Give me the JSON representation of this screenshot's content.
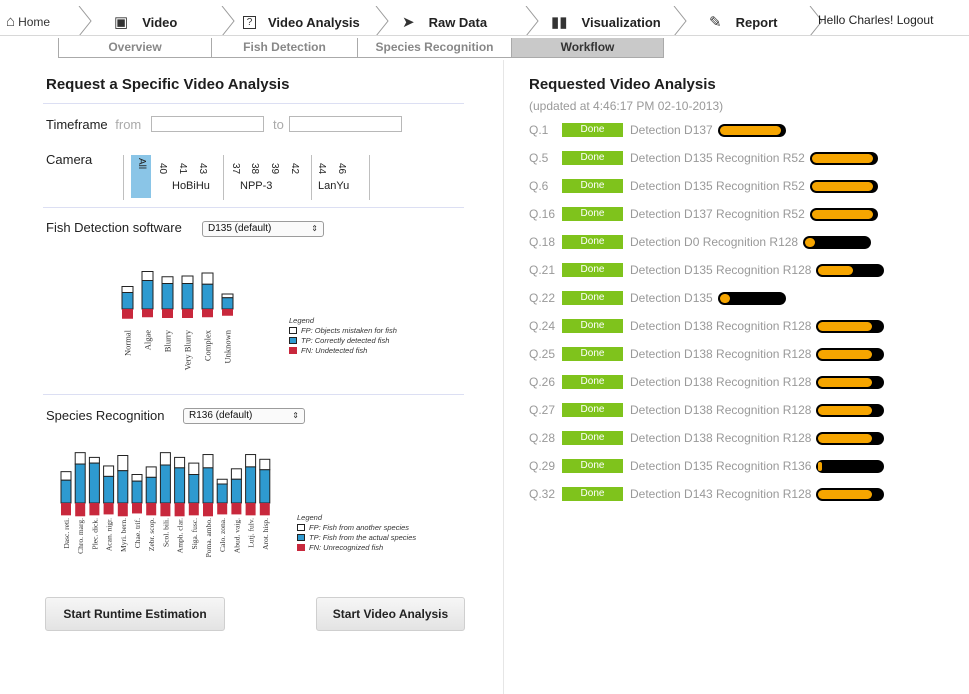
{
  "nav": {
    "home": "Home",
    "steps": [
      {
        "label": "Video",
        "icon": "video-icon"
      },
      {
        "label": "Video Analysis",
        "icon": "help-icon"
      },
      {
        "label": "Raw Data",
        "icon": "fish-icon"
      },
      {
        "label": "Visualization",
        "icon": "bar-chart-icon"
      },
      {
        "label": "Report",
        "icon": "edit-icon"
      }
    ],
    "greeting": "Hello Charles!",
    "logout": "Logout"
  },
  "subtabs": [
    "Overview",
    "Fish Detection",
    "Species Recognition",
    "Workflow"
  ],
  "request": {
    "title": "Request a Specific Video Analysis",
    "timeframe_label": "Timeframe",
    "from_label": "from",
    "to_label": "to",
    "from_value": "",
    "to_value": "",
    "camera_label": "Camera",
    "camera_all": "All",
    "camera_numbers": [
      "40",
      "41",
      "43",
      "37",
      "38",
      "39",
      "42",
      "44",
      "46"
    ],
    "camera_groups": [
      "HoBiHu",
      "NPP-3",
      "LanYu"
    ],
    "fish_detection_label": "Fish Detection software",
    "fish_detection_value": "D135 (default)",
    "species_label": "Species Recognition",
    "species_value": "R136 (default)",
    "start_runtime": "Start Runtime Estimation",
    "start_video": "Start Video Analysis"
  },
  "colors": {
    "fp": "#ffffff",
    "tp": "#2e9ad0",
    "fn": "#c8283c",
    "done": "#7fc31c",
    "progress": "#f6a500"
  },
  "chart_data": [
    {
      "type": "bar",
      "title": "",
      "categories": [
        "Normal",
        "Algae",
        "Blurry",
        "Very Blurry",
        "Complex",
        "Unknown"
      ],
      "series": [
        {
          "name": "FP: Objects mistaken for fish",
          "values": [
            8,
            12,
            9,
            10,
            15,
            5
          ]
        },
        {
          "name": "TP: Correctly detected fish",
          "values": [
            22,
            38,
            34,
            34,
            33,
            15
          ]
        },
        {
          "name": "FN: Undetected fish",
          "values": [
            13,
            11,
            12,
            12,
            11,
            9
          ]
        }
      ],
      "legend_title": "Legend",
      "legend": [
        "FP: Objects mistaken for fish",
        "TP: Correctly detected fish",
        "FN: Undetected fish"
      ]
    },
    {
      "type": "bar",
      "title": "",
      "categories": [
        "Dasc. reti.",
        "Chro. marg.",
        "Plec. dick.",
        "Acan. nigr.",
        "Myri. bern.",
        "Chae. trif.",
        "Zebr. scop.",
        "Scol. bili.",
        "Amph. clar.",
        "Siga. fusc.",
        "Poma. ambo.",
        "Calo. zona.",
        "Abud. vaig.",
        "Lutj. fulv.",
        "Arot. hisp."
      ],
      "series": [
        {
          "name": "FP: Fish from another species",
          "values": [
            9,
            12,
            6,
            11,
            16,
            7,
            11,
            13,
            11,
            12,
            14,
            5,
            11,
            13,
            11
          ]
        },
        {
          "name": "TP: Fish from the actual species",
          "values": [
            24,
            41,
            42,
            28,
            34,
            23,
            27,
            40,
            37,
            30,
            37,
            20,
            25,
            38,
            35
          ]
        },
        {
          "name": "FN: Unrecognized fish",
          "values": [
            13,
            14,
            13,
            12,
            14,
            11,
            13,
            14,
            14,
            13,
            14,
            12,
            12,
            13,
            13
          ]
        }
      ],
      "legend_title": "Legend",
      "legend": [
        "FP: Fish from another species",
        "TP: Fish from the actual species",
        "FN: Unrecognized fish"
      ]
    }
  ],
  "requested": {
    "title": "Requested Video Analysis",
    "updated": "(updated at 4:46:17 PM 02-10-2013)",
    "rows": [
      {
        "id": "Q.1",
        "status": "Done",
        "desc": "Detection D137",
        "progress": 0.95
      },
      {
        "id": "Q.5",
        "status": "Done",
        "desc": "Detection D135 Recognition R52",
        "progress": 0.95
      },
      {
        "id": "Q.6",
        "status": "Done",
        "desc": "Detection D135 Recognition R52",
        "progress": 0.95
      },
      {
        "id": "Q.16",
        "status": "Done",
        "desc": "Detection D137 Recognition R52",
        "progress": 0.95
      },
      {
        "id": "Q.18",
        "status": "Done",
        "desc": "Detection D0 Recognition R128",
        "progress": 0.15
      },
      {
        "id": "Q.21",
        "status": "Done",
        "desc": "Detection D135 Recognition R128",
        "progress": 0.55
      },
      {
        "id": "Q.22",
        "status": "Done",
        "desc": "Detection D135",
        "progress": 0.15
      },
      {
        "id": "Q.24",
        "status": "Done",
        "desc": "Detection D138 Recognition R128",
        "progress": 0.85
      },
      {
        "id": "Q.25",
        "status": "Done",
        "desc": "Detection D138 Recognition R128",
        "progress": 0.85
      },
      {
        "id": "Q.26",
        "status": "Done",
        "desc": "Detection D138 Recognition R128",
        "progress": 0.85
      },
      {
        "id": "Q.27",
        "status": "Done",
        "desc": "Detection D138 Recognition R128",
        "progress": 0.85
      },
      {
        "id": "Q.28",
        "status": "Done",
        "desc": "Detection D138 Recognition R128",
        "progress": 0.85
      },
      {
        "id": "Q.29",
        "status": "Done",
        "desc": "Detection D135 Recognition R136",
        "progress": 0.05
      },
      {
        "id": "Q.32",
        "status": "Done",
        "desc": "Detection D143 Recognition R128",
        "progress": 0.85
      }
    ]
  }
}
